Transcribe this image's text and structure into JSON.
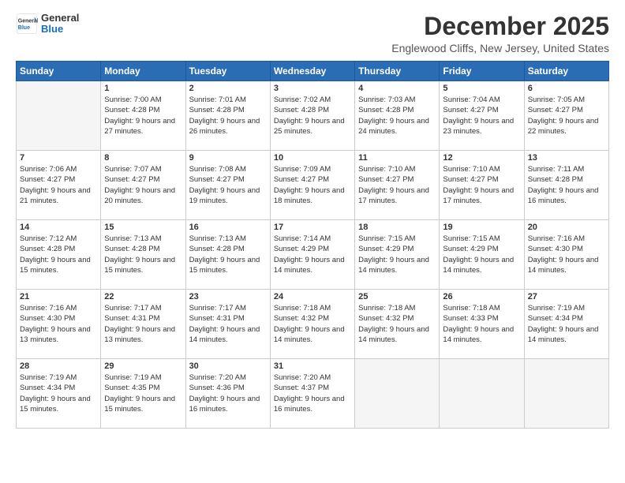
{
  "logo": {
    "general": "General",
    "blue": "Blue"
  },
  "title": "December 2025",
  "location": "Englewood Cliffs, New Jersey, United States",
  "days_of_week": [
    "Sunday",
    "Monday",
    "Tuesday",
    "Wednesday",
    "Thursday",
    "Friday",
    "Saturday"
  ],
  "weeks": [
    [
      {
        "day": "",
        "empty": true
      },
      {
        "day": "1",
        "sunrise": "7:00 AM",
        "sunset": "4:28 PM",
        "daylight": "9 hours and 27 minutes."
      },
      {
        "day": "2",
        "sunrise": "7:01 AM",
        "sunset": "4:28 PM",
        "daylight": "9 hours and 26 minutes."
      },
      {
        "day": "3",
        "sunrise": "7:02 AM",
        "sunset": "4:28 PM",
        "daylight": "9 hours and 25 minutes."
      },
      {
        "day": "4",
        "sunrise": "7:03 AM",
        "sunset": "4:28 PM",
        "daylight": "9 hours and 24 minutes."
      },
      {
        "day": "5",
        "sunrise": "7:04 AM",
        "sunset": "4:27 PM",
        "daylight": "9 hours and 23 minutes."
      },
      {
        "day": "6",
        "sunrise": "7:05 AM",
        "sunset": "4:27 PM",
        "daylight": "9 hours and 22 minutes."
      }
    ],
    [
      {
        "day": "7",
        "sunrise": "7:06 AM",
        "sunset": "4:27 PM",
        "daylight": "9 hours and 21 minutes."
      },
      {
        "day": "8",
        "sunrise": "7:07 AM",
        "sunset": "4:27 PM",
        "daylight": "9 hours and 20 minutes."
      },
      {
        "day": "9",
        "sunrise": "7:08 AM",
        "sunset": "4:27 PM",
        "daylight": "9 hours and 19 minutes."
      },
      {
        "day": "10",
        "sunrise": "7:09 AM",
        "sunset": "4:27 PM",
        "daylight": "9 hours and 18 minutes."
      },
      {
        "day": "11",
        "sunrise": "7:10 AM",
        "sunset": "4:27 PM",
        "daylight": "9 hours and 17 minutes."
      },
      {
        "day": "12",
        "sunrise": "7:10 AM",
        "sunset": "4:27 PM",
        "daylight": "9 hours and 17 minutes."
      },
      {
        "day": "13",
        "sunrise": "7:11 AM",
        "sunset": "4:28 PM",
        "daylight": "9 hours and 16 minutes."
      }
    ],
    [
      {
        "day": "14",
        "sunrise": "7:12 AM",
        "sunset": "4:28 PM",
        "daylight": "9 hours and 15 minutes."
      },
      {
        "day": "15",
        "sunrise": "7:13 AM",
        "sunset": "4:28 PM",
        "daylight": "9 hours and 15 minutes."
      },
      {
        "day": "16",
        "sunrise": "7:13 AM",
        "sunset": "4:28 PM",
        "daylight": "9 hours and 15 minutes."
      },
      {
        "day": "17",
        "sunrise": "7:14 AM",
        "sunset": "4:29 PM",
        "daylight": "9 hours and 14 minutes."
      },
      {
        "day": "18",
        "sunrise": "7:15 AM",
        "sunset": "4:29 PM",
        "daylight": "9 hours and 14 minutes."
      },
      {
        "day": "19",
        "sunrise": "7:15 AM",
        "sunset": "4:29 PM",
        "daylight": "9 hours and 14 minutes."
      },
      {
        "day": "20",
        "sunrise": "7:16 AM",
        "sunset": "4:30 PM",
        "daylight": "9 hours and 14 minutes."
      }
    ],
    [
      {
        "day": "21",
        "sunrise": "7:16 AM",
        "sunset": "4:30 PM",
        "daylight": "9 hours and 13 minutes."
      },
      {
        "day": "22",
        "sunrise": "7:17 AM",
        "sunset": "4:31 PM",
        "daylight": "9 hours and 13 minutes."
      },
      {
        "day": "23",
        "sunrise": "7:17 AM",
        "sunset": "4:31 PM",
        "daylight": "9 hours and 14 minutes."
      },
      {
        "day": "24",
        "sunrise": "7:18 AM",
        "sunset": "4:32 PM",
        "daylight": "9 hours and 14 minutes."
      },
      {
        "day": "25",
        "sunrise": "7:18 AM",
        "sunset": "4:32 PM",
        "daylight": "9 hours and 14 minutes."
      },
      {
        "day": "26",
        "sunrise": "7:18 AM",
        "sunset": "4:33 PM",
        "daylight": "9 hours and 14 minutes."
      },
      {
        "day": "27",
        "sunrise": "7:19 AM",
        "sunset": "4:34 PM",
        "daylight": "9 hours and 14 minutes."
      }
    ],
    [
      {
        "day": "28",
        "sunrise": "7:19 AM",
        "sunset": "4:34 PM",
        "daylight": "9 hours and 15 minutes."
      },
      {
        "day": "29",
        "sunrise": "7:19 AM",
        "sunset": "4:35 PM",
        "daylight": "9 hours and 15 minutes."
      },
      {
        "day": "30",
        "sunrise": "7:20 AM",
        "sunset": "4:36 PM",
        "daylight": "9 hours and 16 minutes."
      },
      {
        "day": "31",
        "sunrise": "7:20 AM",
        "sunset": "4:37 PM",
        "daylight": "9 hours and 16 minutes."
      },
      {
        "day": "",
        "empty": true
      },
      {
        "day": "",
        "empty": true
      },
      {
        "day": "",
        "empty": true
      }
    ]
  ]
}
